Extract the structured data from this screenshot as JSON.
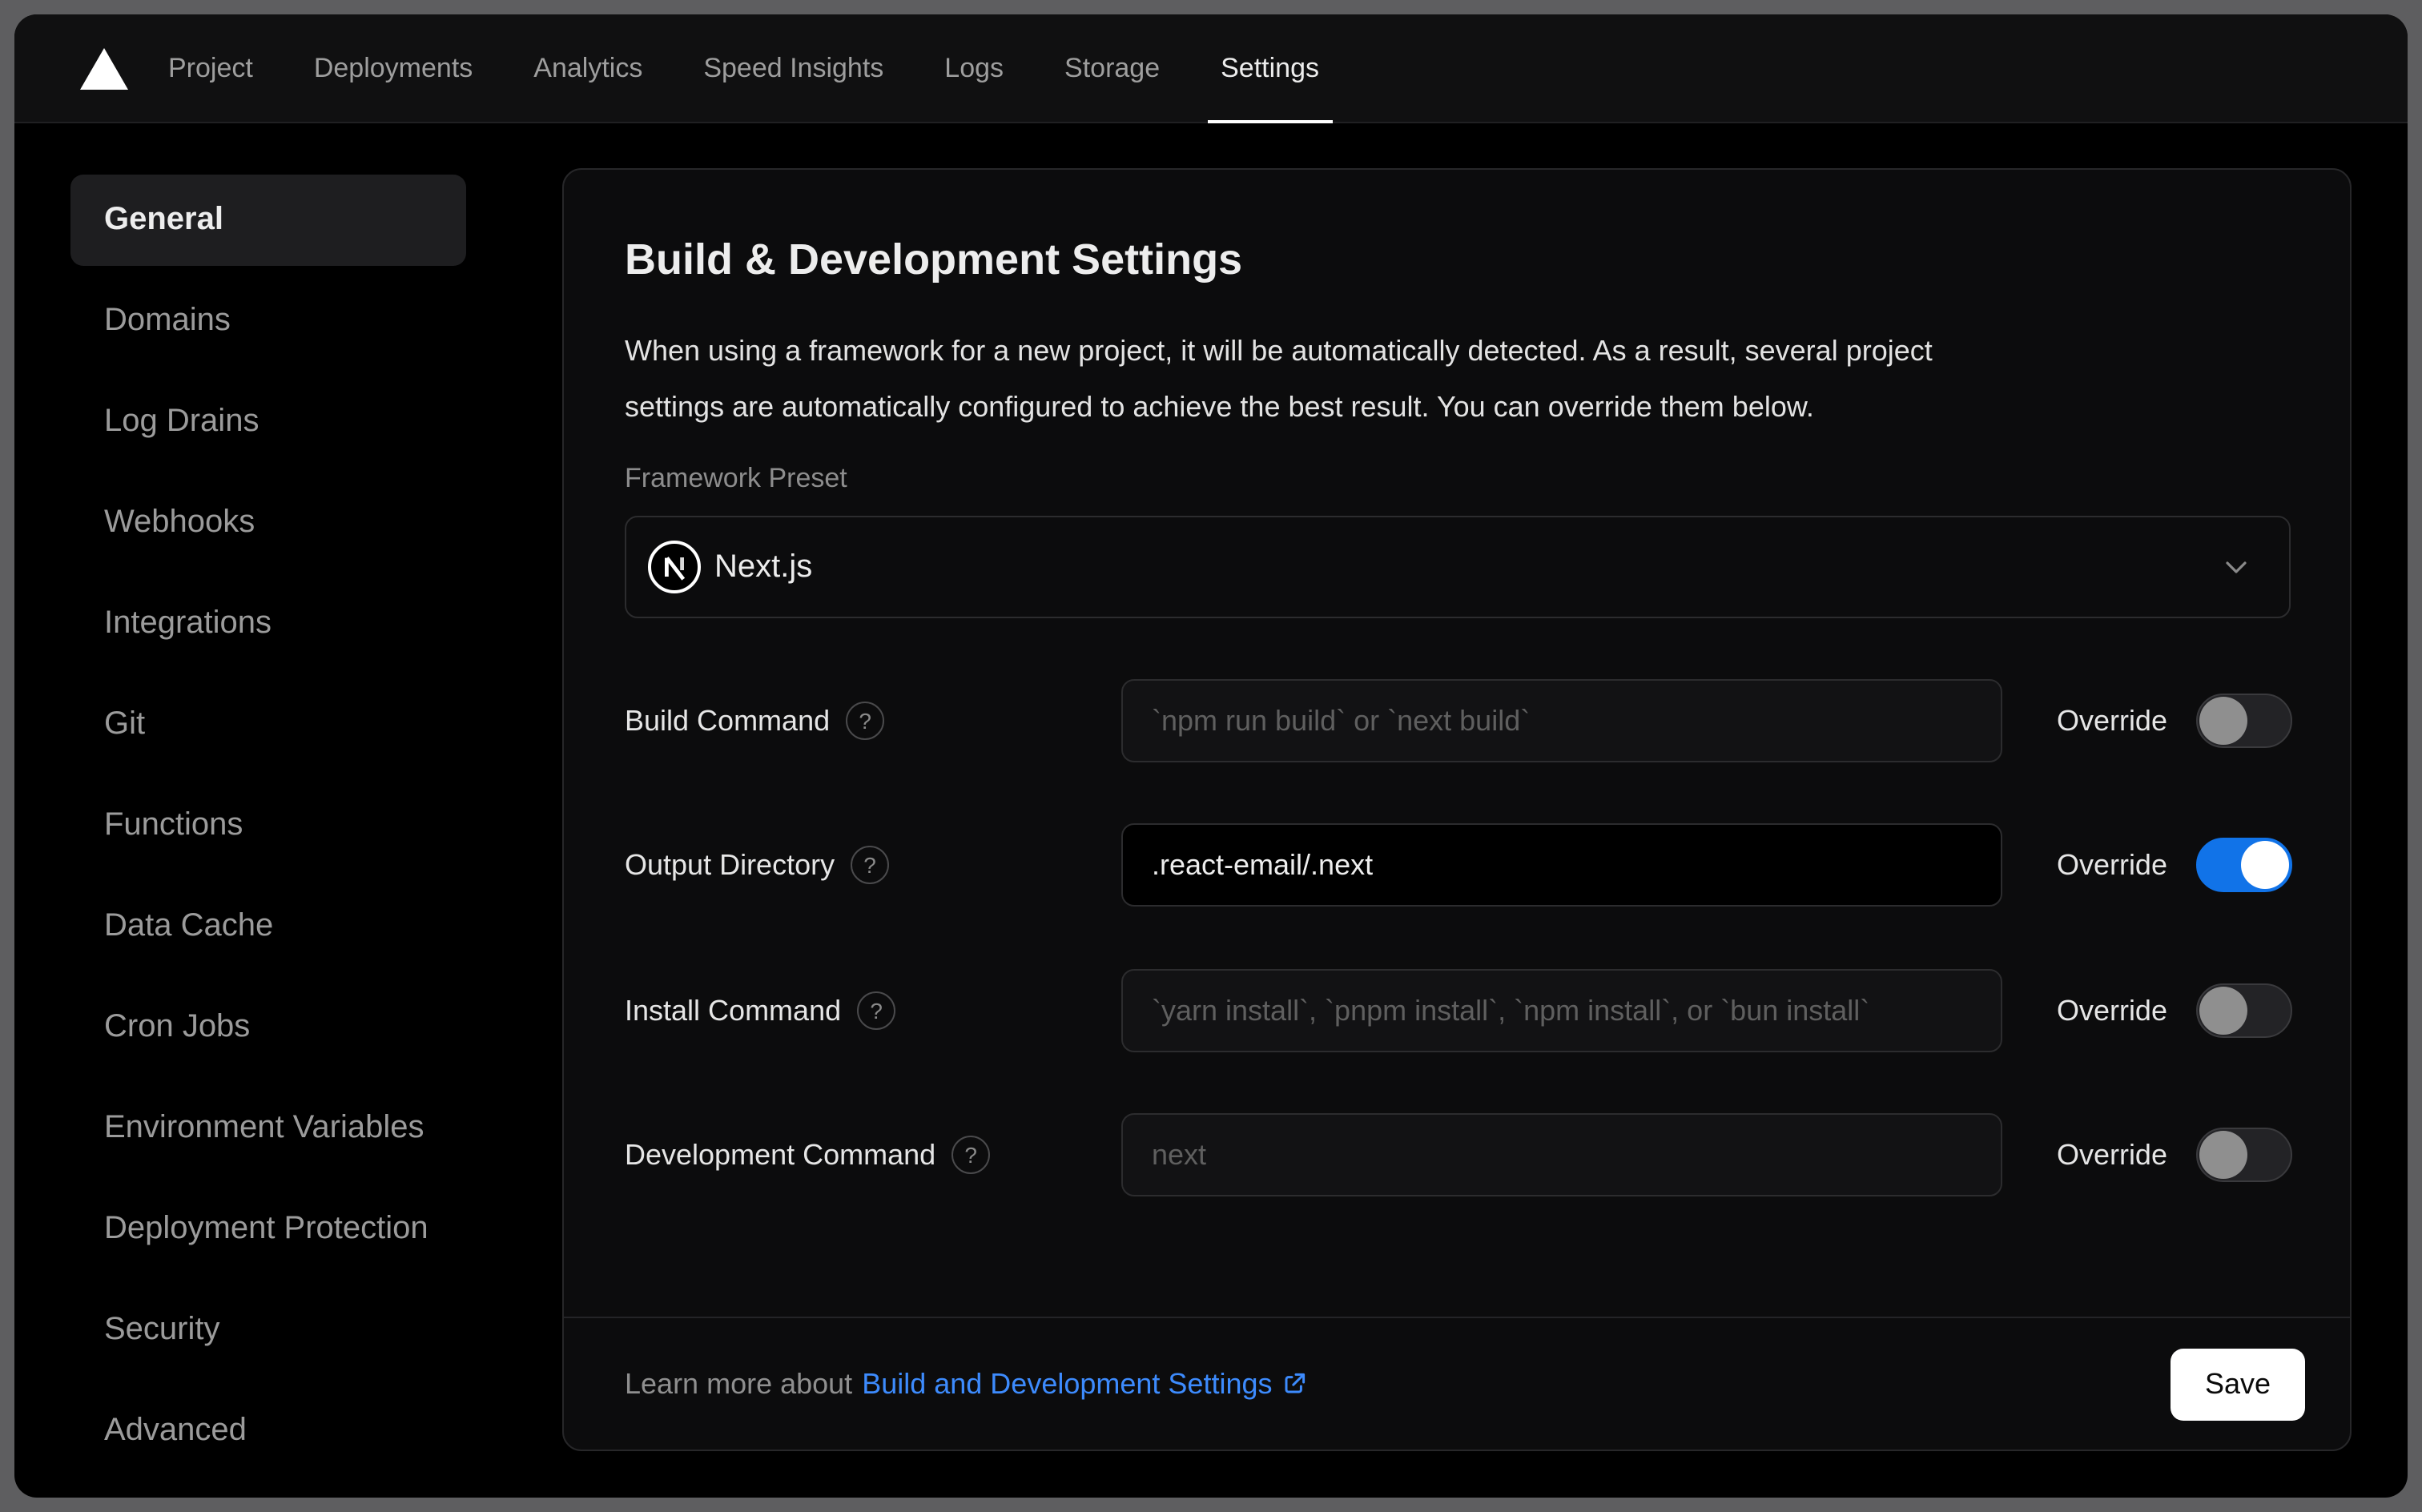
{
  "colors": {
    "toggle_on_blue": "#1173e8",
    "link_blue": "#3d8bfd",
    "save_bg": "#ffffff",
    "save_text": "#0a0a0a",
    "card_bg": "#0c0c0d",
    "active_pill_bg": "#1e1e20"
  },
  "nav": {
    "items": [
      {
        "label": "Project",
        "active": false
      },
      {
        "label": "Deployments",
        "active": false
      },
      {
        "label": "Analytics",
        "active": false
      },
      {
        "label": "Speed Insights",
        "active": false
      },
      {
        "label": "Logs",
        "active": false
      },
      {
        "label": "Storage",
        "active": false
      },
      {
        "label": "Settings",
        "active": true
      }
    ]
  },
  "sidebar": {
    "items": [
      {
        "label": "General",
        "active": true
      },
      {
        "label": "Domains",
        "active": false
      },
      {
        "label": "Log Drains",
        "active": false
      },
      {
        "label": "Webhooks",
        "active": false
      },
      {
        "label": "Integrations",
        "active": false
      },
      {
        "label": "Git",
        "active": false
      },
      {
        "label": "Functions",
        "active": false
      },
      {
        "label": "Data Cache",
        "active": false
      },
      {
        "label": "Cron Jobs",
        "active": false
      },
      {
        "label": "Environment Variables",
        "active": false
      },
      {
        "label": "Deployment Protection",
        "active": false
      },
      {
        "label": "Security",
        "active": false
      },
      {
        "label": "Advanced",
        "active": false
      }
    ]
  },
  "panel": {
    "title": "Build & Development Settings",
    "description": "When using a framework for a new project, it will be automatically detected. As a result, several project\nsettings are automatically configured to achieve the best result. You can override them below.",
    "framework_preset": {
      "label": "Framework Preset",
      "value": "Next.js"
    },
    "override_label": "Override",
    "help_glyph": "?",
    "rows": [
      {
        "label": "Build Command",
        "placeholder": "`npm run build` or `next build`",
        "value": "",
        "override": false
      },
      {
        "label": "Output Directory",
        "placeholder": "",
        "value": ".react-email/.next",
        "override": true
      },
      {
        "label": "Install Command",
        "placeholder": "`yarn install`, `pnpm install`, `npm install`, or `bun install`",
        "value": "",
        "override": false
      },
      {
        "label": "Development Command",
        "placeholder": "next",
        "value": "",
        "override": false
      }
    ],
    "footer": {
      "prefix": "Learn more about",
      "link_label": "Build and Development Settings",
      "save_label": "Save"
    }
  }
}
